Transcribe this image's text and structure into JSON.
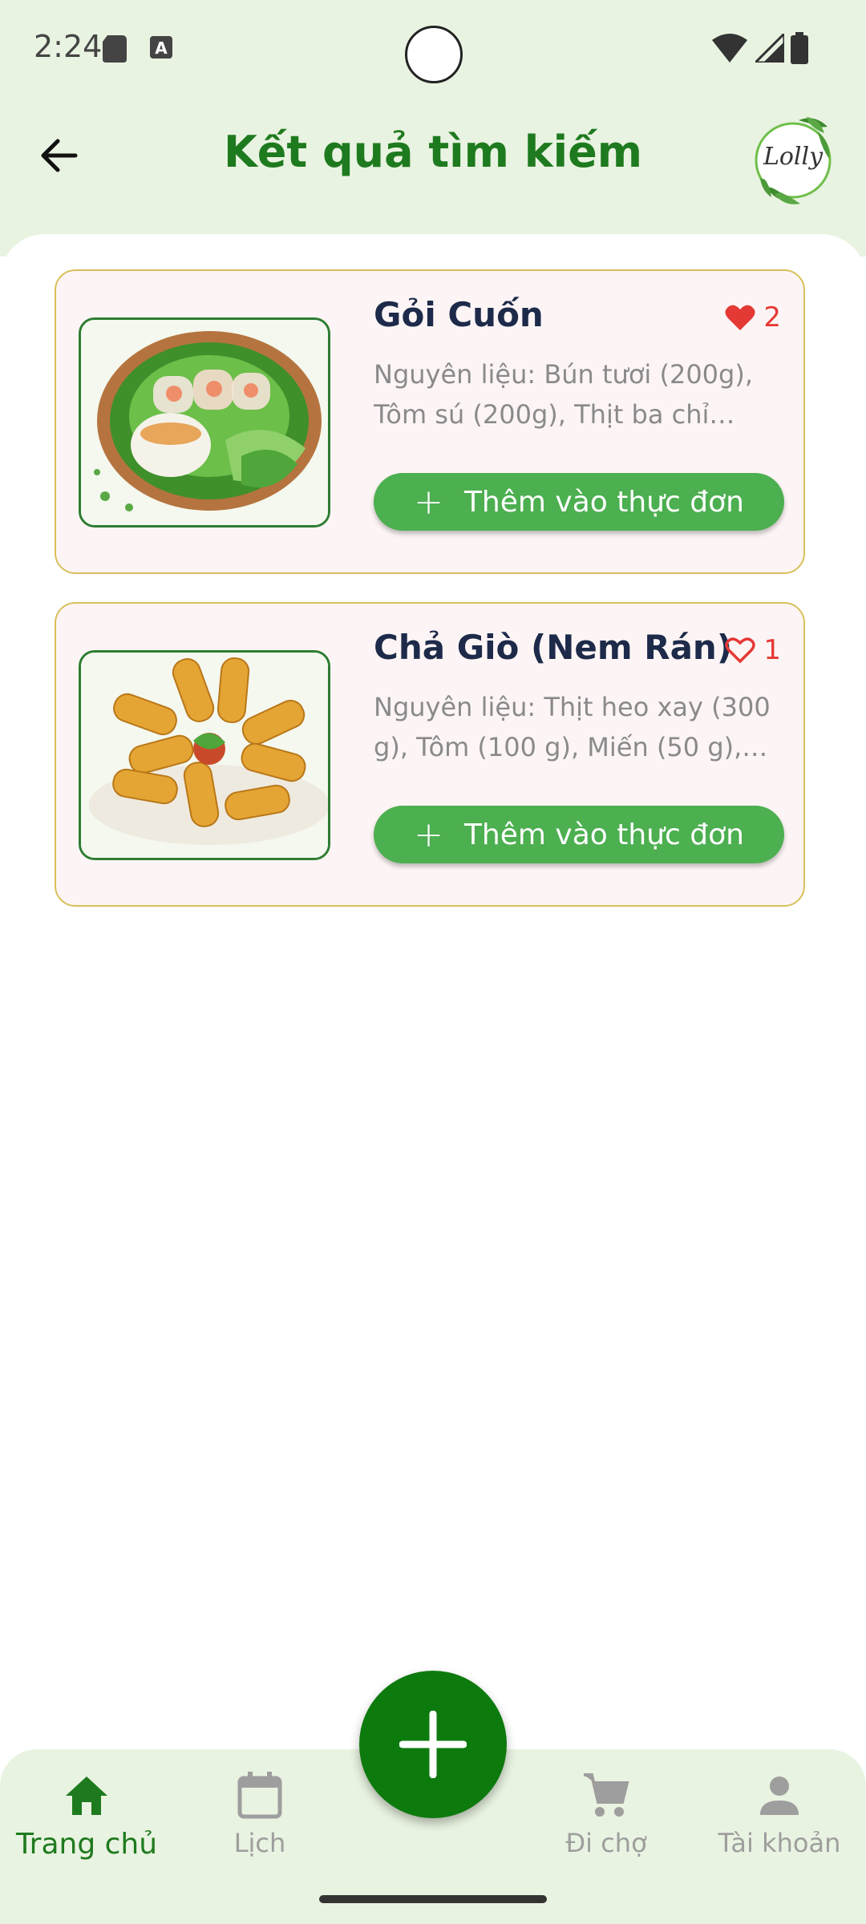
{
  "status_bar": {
    "time": "2:24"
  },
  "header": {
    "title": "Kết quả tìm kiếm",
    "logo_text": "Lolly"
  },
  "results": [
    {
      "title": "Gỏi Cuốn",
      "likes": "2",
      "liked": true,
      "description": "Nguyên liệu: Bún tươi (200g), Tôm sú (200g), Thịt ba chỉ (200...",
      "button_label": "Thêm vào thực đơn",
      "image_icon": "spring-rolls-image"
    },
    {
      "title": "Chả Giò (Nem Rán)",
      "likes": "1",
      "liked": false,
      "description": "Nguyên liệu: Thịt heo xay (300 g), Tôm (100 g), Miến (50 g), Nấ...",
      "button_label": "Thêm vào thực đơn",
      "image_icon": "fried-rolls-image"
    }
  ],
  "bottom_nav": {
    "items": [
      {
        "label": "Trang chủ",
        "icon": "home-icon",
        "active": true
      },
      {
        "label": "Lịch",
        "icon": "calendar-icon",
        "active": false
      },
      {
        "label": "Đi chợ",
        "icon": "cart-icon",
        "active": false
      },
      {
        "label": "Tài khoản",
        "icon": "person-icon",
        "active": false
      }
    ]
  },
  "colors": {
    "primary_green": "#1e7a1e",
    "button_green": "#4caf50",
    "header_bg": "#e9f3e1",
    "card_border": "#d9c05a",
    "like_red": "#e53935"
  }
}
